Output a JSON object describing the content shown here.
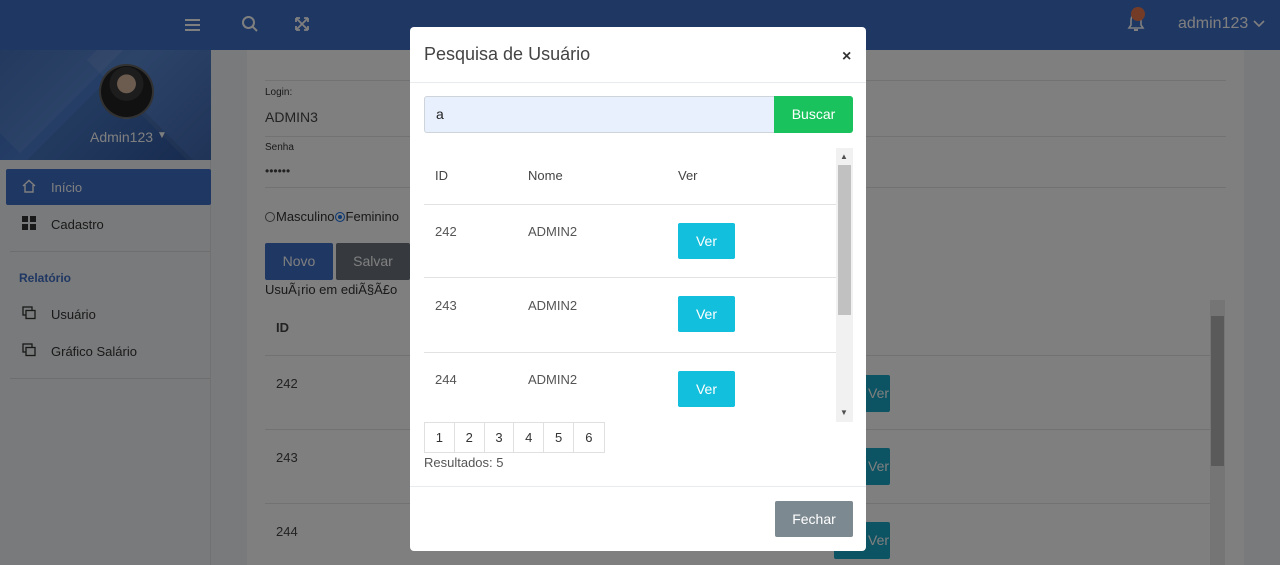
{
  "topbar": {
    "menu_icon": "hamburger-icon",
    "search_icon": "search-icon",
    "fullscreen_icon": "expand-icon",
    "bell_icon": "bell-icon",
    "user_label": "admin123",
    "brand_color": "#3f6fc6"
  },
  "sidebar": {
    "profile_name": "Admin123",
    "items": [
      {
        "label": "Início",
        "icon": "home-icon",
        "active": true
      },
      {
        "label": "Cadastro",
        "icon": "grid-icon",
        "active": false
      }
    ],
    "section_title": "Relatório",
    "report_items": [
      {
        "label": "Usuário",
        "icon": "copy-icon"
      },
      {
        "label": "Gráfico Salário",
        "icon": "copy-icon"
      }
    ]
  },
  "form": {
    "login_label": "Login:",
    "login_value": "ADMIN3",
    "password_label": "Senha",
    "password_value": "••••••",
    "gender_options": [
      "Masculino",
      "Feminino"
    ],
    "gender_selected": "Feminino",
    "new_button": "Novo",
    "save_button": "Salvar",
    "status_text": "UsuÃ¡rio em ediÃ§Ã£o",
    "table_header_id": "ID",
    "rows": [
      {
        "id": "242",
        "action": "Ver"
      },
      {
        "id": "243",
        "action": "Ver"
      },
      {
        "id": "244",
        "action": "Ver"
      }
    ]
  },
  "modal": {
    "title": "Pesquisa de Usuário",
    "close_glyph": "×",
    "search_value": "a",
    "search_button": "Buscar",
    "columns": [
      "ID",
      "Nome",
      "Ver"
    ],
    "rows": [
      {
        "id": "242",
        "name": "ADMIN2",
        "action": "Ver"
      },
      {
        "id": "243",
        "name": "ADMIN2",
        "action": "Ver"
      },
      {
        "id": "244",
        "name": "ADMIN2",
        "action": "Ver"
      }
    ],
    "pages": [
      "1",
      "2",
      "3",
      "4",
      "5",
      "6"
    ],
    "results_text": "Resultados: 5",
    "close_button": "Fechar"
  }
}
